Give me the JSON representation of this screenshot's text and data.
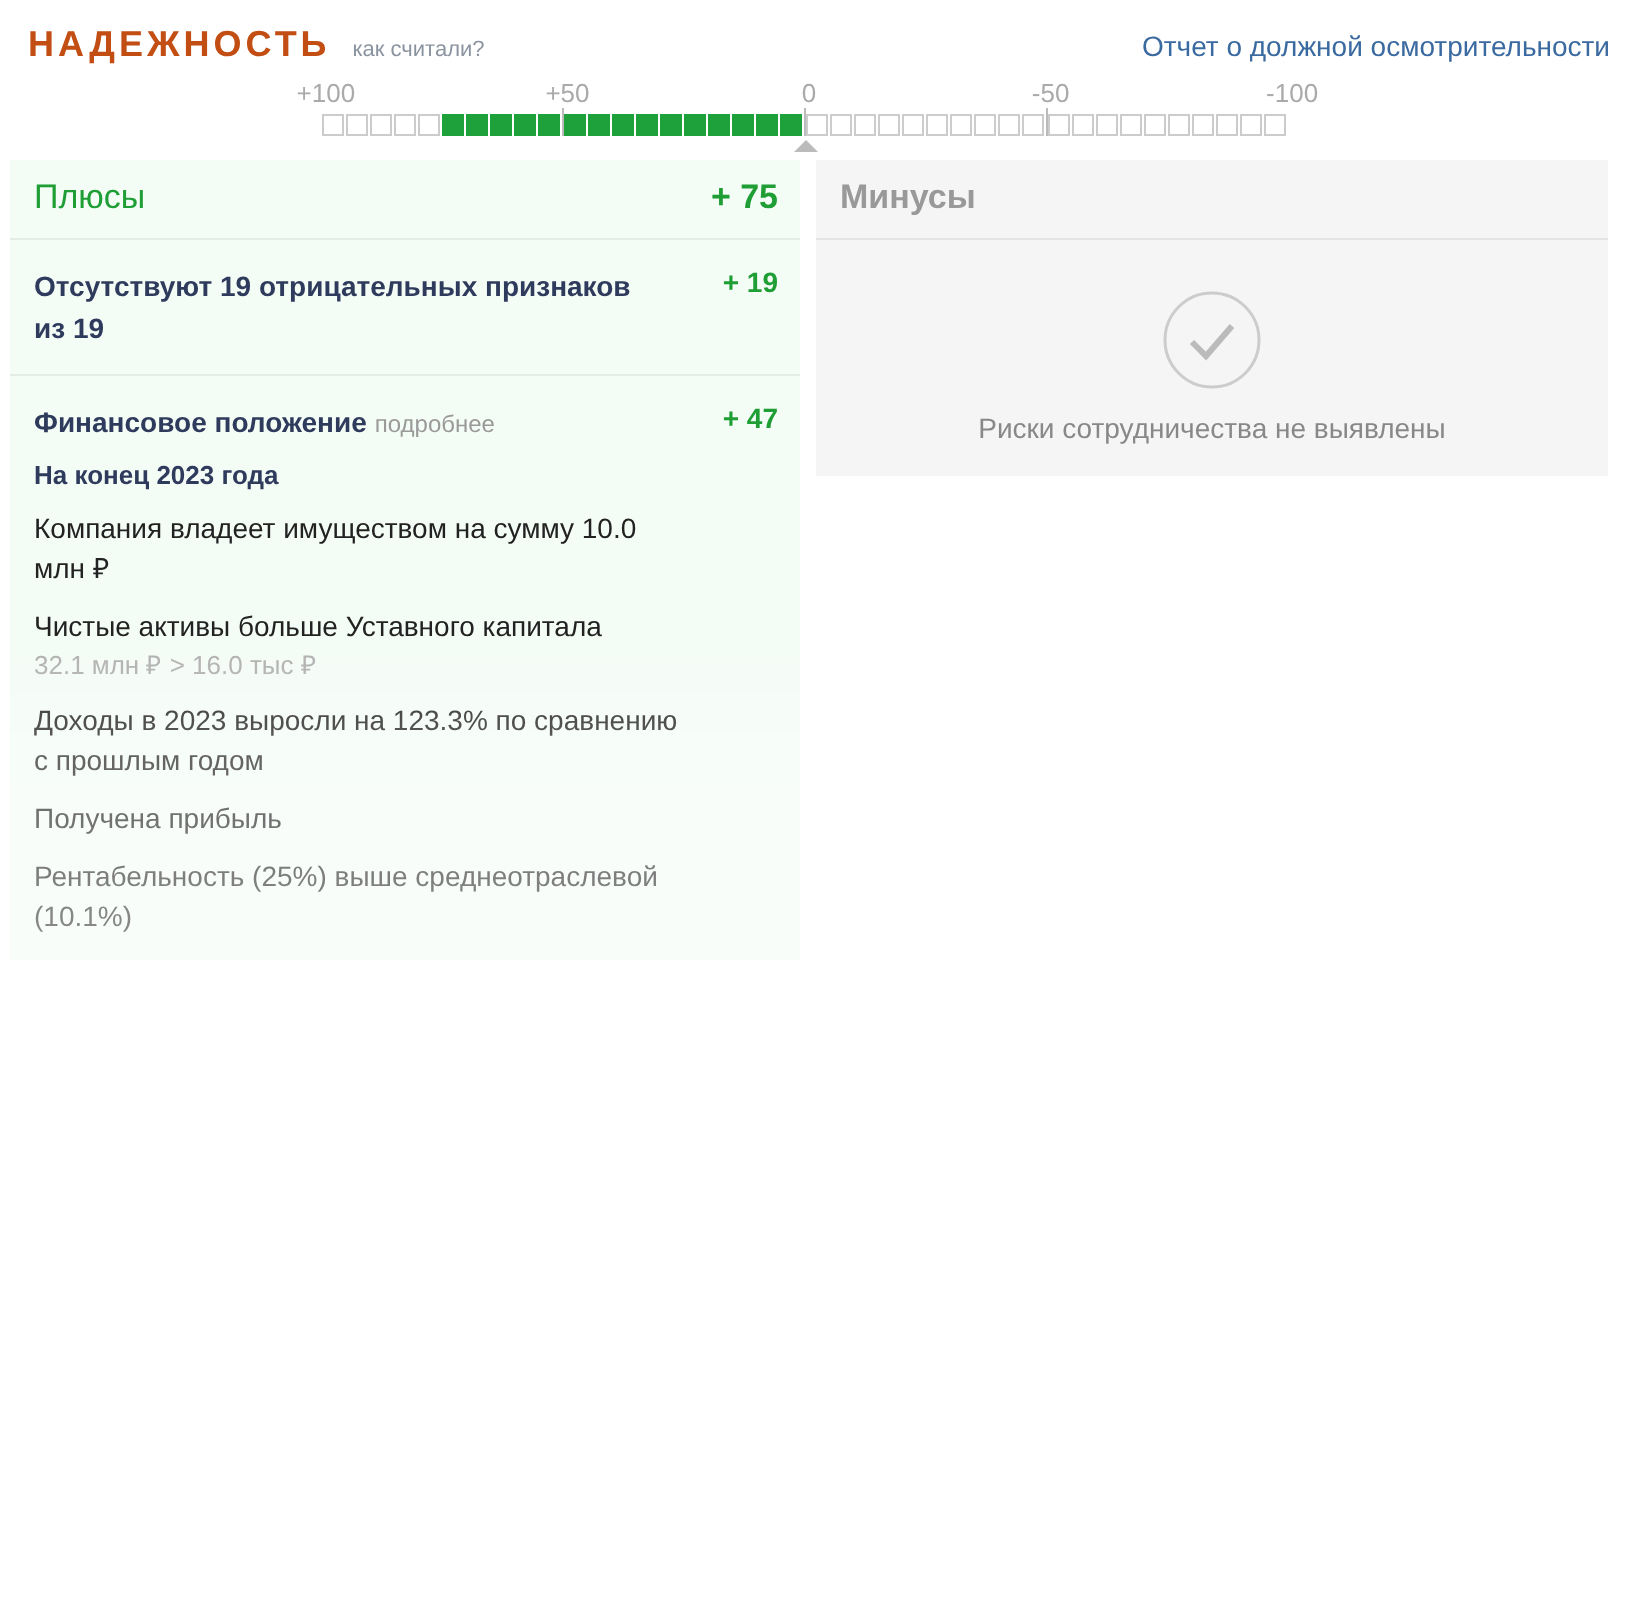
{
  "header": {
    "title": "НАДЕЖНОСТЬ",
    "help_link": "как считали?",
    "report_link": "Отчет о должной осмотрительности"
  },
  "scale": {
    "ticks": [
      "+100",
      "+50",
      "0",
      "-50",
      "-100"
    ]
  },
  "pluses": {
    "title": "Плюсы",
    "score": "+ 75",
    "groups": [
      {
        "title": "Отсутствуют 19 отрицательных признаков из 19",
        "score": "+ 19"
      },
      {
        "title": "Финансовое положение",
        "more": "подробнее",
        "score": "+ 47",
        "period": "На конец 2023 года",
        "facts": [
          {
            "text": "Компания владеет имуществом на сумму 10.0 млн ₽"
          },
          {
            "text": "Чистые активы больше Уставного капитала",
            "note": "32.1 млн ₽ > 16.0 тыс ₽"
          },
          {
            "text": "Доходы в 2023 выросли на 123.3% по сравнению с прошлым годом"
          },
          {
            "text": "Получена прибыль"
          },
          {
            "text": "Рентабельность (25%) выше среднеотраслевой (10.1%)"
          }
        ]
      }
    ]
  },
  "minuses": {
    "title": "Минусы",
    "empty_text": "Риски сотрудничества не выявлены"
  }
}
